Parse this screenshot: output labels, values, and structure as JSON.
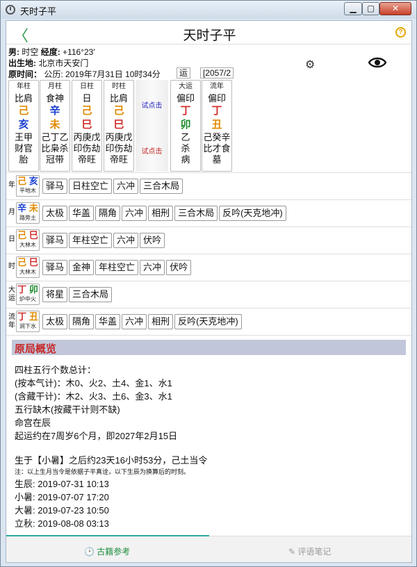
{
  "window": {
    "title": "天时子平",
    "min": "▁",
    "max": "▢",
    "close": "✕"
  },
  "header": {
    "title": "天时子平",
    "back": "〈",
    "help": "?"
  },
  "info": {
    "gender_label": "男:",
    "gender_value": "时空",
    "lon_label": "经度:",
    "lon_value": "+116°23'",
    "place_label": "出生地:",
    "place_value": "北京市天安门",
    "time_label": "原时间：",
    "time_value": "公历: 2019年7月31日 10时34分"
  },
  "yun_btn": "运",
  "year_btn": "[2057/2",
  "pillars": [
    {
      "hd": "年柱",
      "top": "比肩",
      "gan": "己",
      "zhi": "亥",
      "h1": "王甲",
      "h2": "财官",
      "h3": "胎",
      "gan_color": "#e08a00",
      "zhi_color": "#1a3fcf"
    },
    {
      "hd": "月柱",
      "top": "食神",
      "gan": "辛",
      "zhi": "未",
      "h1": "己丁乙",
      "h2": "比枭杀",
      "h3": "冠带",
      "gan_color": "#1a3fcf",
      "zhi_color": "#e08a00"
    },
    {
      "hd": "日柱",
      "top": "日",
      "gan": "己",
      "zhi": "巳",
      "h1": "丙庚戊",
      "h2": "印伤劫",
      "h3": "帝旺",
      "gan_color": "#e08a00",
      "zhi_color": "#d32f2f"
    },
    {
      "hd": "时柱",
      "top": "比肩",
      "gan": "己",
      "zhi": "巳",
      "h1": "丙庚戊",
      "h2": "印伤劫",
      "h3": "帝旺",
      "gan_color": "#e08a00",
      "zhi_color": "#d32f2f"
    },
    {
      "hd": "大运",
      "top": "偏印",
      "gan": "丁",
      "zhi": "卯",
      "h1": "乙",
      "h2": "杀",
      "h3": "病",
      "gan_color": "#d32f2f",
      "zhi_color": "#1a8a2a"
    },
    {
      "hd": "流年",
      "top": "偏印",
      "gan": "丁",
      "zhi": "丑",
      "h1": "己癸辛",
      "h2": "比才食",
      "h3": "墓",
      "gan_color": "#d32f2f",
      "zhi_color": "#e08a00"
    }
  ],
  "try": {
    "t1": "试点击",
    "t2": "试点击"
  },
  "rows": [
    {
      "label": "年",
      "g": "己",
      "z": "亥",
      "gc": "#e08a00",
      "zc": "#1a3fcf",
      "nayin": "平地木",
      "tags": [
        "驿马",
        "日柱空亡",
        "六冲",
        "三合木局"
      ]
    },
    {
      "label": "月",
      "g": "辛",
      "z": "未",
      "gc": "#1a3fcf",
      "zc": "#e08a00",
      "nayin": "路旁土",
      "tags": [
        "太极",
        "华盖",
        "隔角",
        "六冲",
        "相刑",
        "三合木局",
        "反吟(天克地冲)"
      ]
    },
    {
      "label": "日",
      "g": "己",
      "z": "巳",
      "gc": "#e08a00",
      "zc": "#d32f2f",
      "nayin": "大林木",
      "tags": [
        "驿马",
        "年柱空亡",
        "六冲",
        "伏吟"
      ]
    },
    {
      "label": "时",
      "g": "己",
      "z": "巳",
      "gc": "#e08a00",
      "zc": "#d32f2f",
      "nayin": "大林木",
      "tags": [
        "驿马",
        "金神",
        "年柱空亡",
        "六冲",
        "伏吟"
      ]
    },
    {
      "label": "大运",
      "g": "丁",
      "z": "卯",
      "gc": "#d32f2f",
      "zc": "#1a8a2a",
      "nayin": "炉中火",
      "tags": [
        "将星",
        "三合木局"
      ]
    },
    {
      "label": "流年",
      "g": "丁",
      "z": "丑",
      "gc": "#d32f2f",
      "zc": "#e08a00",
      "nayin": "涧下水",
      "tags": [
        "太极",
        "隔角",
        "华盖",
        "六冲",
        "相刑",
        "反吟(天克地冲)"
      ]
    }
  ],
  "section": {
    "title": "原局概览"
  },
  "overview": [
    "四柱五行个数总计：",
    "(按本气计)：木0、火2、土4、金1、水1",
    "(含藏干计)：木2、火3、土6、金3、水1",
    "五行缺木(按藏干计则不缺)",
    "命宫在辰",
    "起运约在7周岁6个月，即2027年2月15日"
  ],
  "solar": {
    "line": "生于【小暑】之后约23天16小时53分，己土当令",
    "note": "注：以上生月当令是依据子平真诠，以下生辰为换算后的时刻。",
    "times": [
      "生辰: 2019-07-31 10:13",
      "小暑: 2019-07-07 17:20",
      "大暑: 2019-07-23 10:50",
      "立秋: 2019-08-08 03:13"
    ]
  },
  "bottom": {
    "b1": "古籍参考",
    "b2": "评语笔记"
  }
}
